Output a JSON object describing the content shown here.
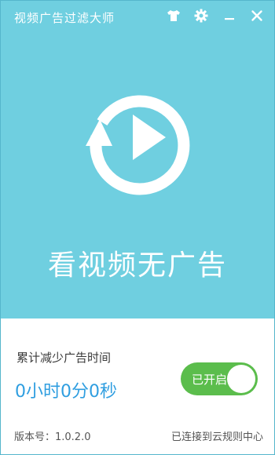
{
  "window": {
    "title": "视频广告过滤大师"
  },
  "titlebar": {
    "skin_icon": "tshirt-icon",
    "settings_icon": "gear-icon",
    "minimize_icon": "minimize-icon",
    "close_icon": "close-icon"
  },
  "hero": {
    "logo_icon": "replay-play-icon",
    "slogan": "看视频无广告"
  },
  "stats": {
    "label": "累计减少广告时间",
    "value": "0小时0分0秒"
  },
  "toggle": {
    "label": "已开启",
    "state": "on"
  },
  "footer": {
    "version": "版本号：1.0.2.0",
    "cloud_status": "已连接到云规则中心"
  },
  "colors": {
    "background": "#6fcfe0",
    "accent_blue": "#2f9ee0",
    "toggle_green": "#5bbd4c",
    "panel": "#ffffff"
  }
}
